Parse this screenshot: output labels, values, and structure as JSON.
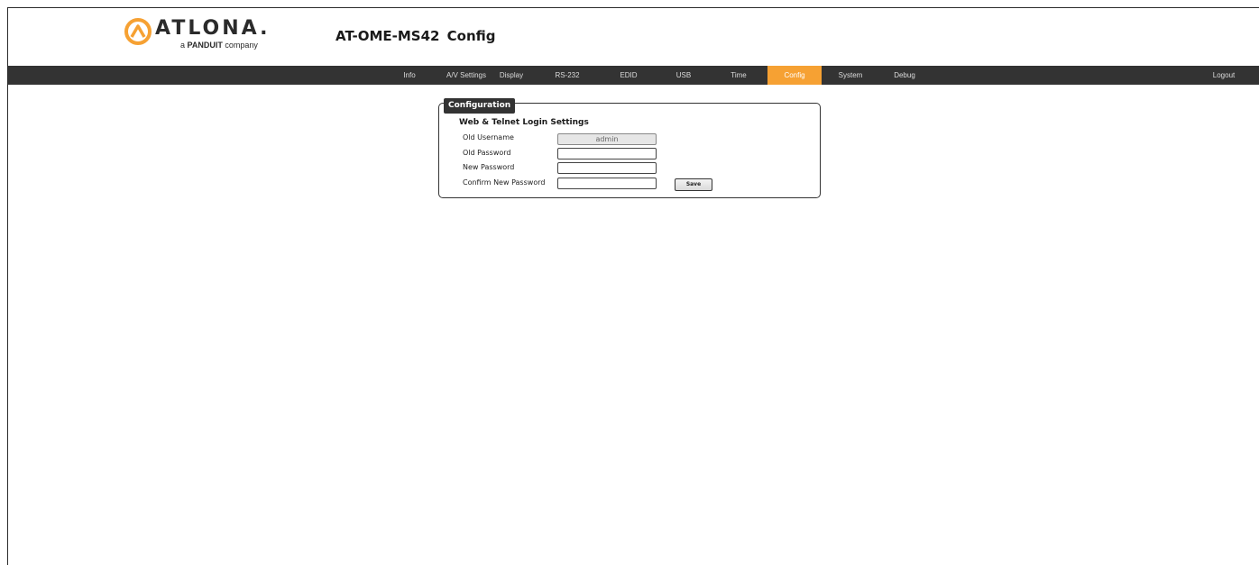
{
  "brand": {
    "logo_text": "ATLONA.",
    "logo_sub_prefix": "a",
    "logo_sub_brand": "PANDUIT",
    "logo_sub_suffix": "company",
    "accent_color": "#f6a133"
  },
  "header": {
    "title": "AT-OME-MS42  Config"
  },
  "nav": {
    "items": [
      {
        "label": "Info"
      },
      {
        "label": "A/V Settings"
      },
      {
        "label": "Display"
      },
      {
        "label": "RS-232"
      },
      {
        "label": "EDID"
      },
      {
        "label": "USB"
      },
      {
        "label": "Time"
      },
      {
        "label": "Config",
        "active": true
      },
      {
        "label": "System"
      },
      {
        "label": "Debug"
      }
    ],
    "logout_label": "Logout"
  },
  "config": {
    "legend": "Configuration",
    "section_title": "Web & Telnet Login Settings",
    "fields": {
      "old_username": {
        "label": "Old Username",
        "value": "admin"
      },
      "old_password": {
        "label": "Old Password",
        "value": ""
      },
      "new_password": {
        "label": "New Password",
        "value": ""
      },
      "confirm_password": {
        "label": "Confirm New Password",
        "value": ""
      }
    },
    "save_label": "Save"
  }
}
